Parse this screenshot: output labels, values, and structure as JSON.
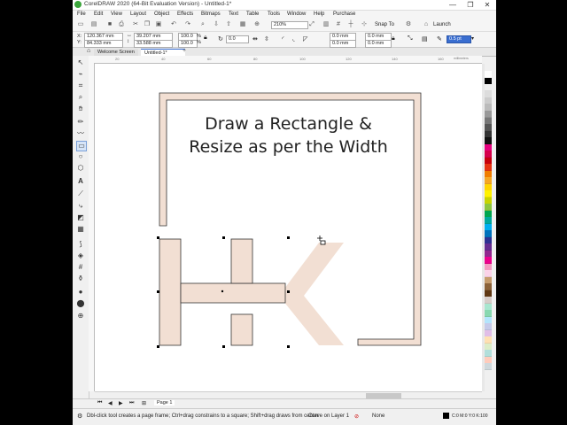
{
  "window": {
    "title": "CorelDRAW 2020 (64-Bit Evaluation Version) - Untitled-1*",
    "minimize": "—",
    "restore": "❐",
    "close": "✕"
  },
  "menu": [
    "File",
    "Edit",
    "View",
    "Layout",
    "Object",
    "Effects",
    "Bitmaps",
    "Text",
    "Table",
    "Tools",
    "Window",
    "Help",
    "Purchase"
  ],
  "toolbar": {
    "zoom": "210%",
    "snap_to": "Snap To",
    "launch": "Launch"
  },
  "property_bar": {
    "x_label": "X:",
    "y_label": "Y:",
    "x": "120.367 mm",
    "y": "84.333 mm",
    "width": "39.207 mm",
    "height": "33.588 mm",
    "scale_x": "100.0",
    "scale_y": "100.0",
    "percent": "%",
    "rotation": "0.0",
    "corner_1": "0.0 mm",
    "corner_2": "0.0 mm",
    "corner_3": "0.0 mm",
    "corner_4": "0.0 mm",
    "outline_width": "0.5 pt"
  },
  "tabs": {
    "welcome": "Welcome Screen",
    "document": "Untitled-1*",
    "add": "+"
  },
  "ruler": {
    "unit": "millimeters",
    "ticks": [
      "20",
      "40",
      "60",
      "80",
      "100",
      "120",
      "140",
      "160"
    ]
  },
  "canvas": {
    "heading_line1": "Draw a Rectangle &",
    "heading_line2": "Resize as per the Width",
    "shape_fill": "#f2dfd3",
    "frame_fill": "#f2dfd3",
    "outline_color": "#333333"
  },
  "document_bar": {
    "page_label": "Page 1"
  },
  "status": {
    "hint": "Dbl-click tool creates a page frame; Ctrl+drag constrains to a square; Shift+drag draws from center",
    "object_info": "Curve on Layer 1",
    "fill_status": "None",
    "color_values": "C:0 M:0 Y:0 K:100",
    "outline_value": "0.500 pt"
  },
  "palette_colors": [
    "#ffffff",
    "#000000",
    "#eeeeee",
    "#dddddd",
    "#cccccc",
    "#bbbbbb",
    "#999999",
    "#777777",
    "#555555",
    "#333333",
    "#111111",
    "#e5007e",
    "#d6004b",
    "#c7000b",
    "#e63312",
    "#f07d00",
    "#f5a623",
    "#ffd400",
    "#fff200",
    "#c8d400",
    "#8dc63f",
    "#00a650",
    "#00a99d",
    "#00aeef",
    "#0072bc",
    "#2e3192",
    "#662d91",
    "#92278f",
    "#ec008c",
    "#f49ac1",
    "#fbd3e9",
    "#c69c6d",
    "#8c6239",
    "#603813",
    "#d7ccc8",
    "#a8e6cf",
    "#88d8b0",
    "#b3e5fc",
    "#c5cae9",
    "#e1bee7",
    "#ffe0b2",
    "#dcedc8",
    "#b2dfdb",
    "#ffccbc",
    "#cfd8dc"
  ]
}
